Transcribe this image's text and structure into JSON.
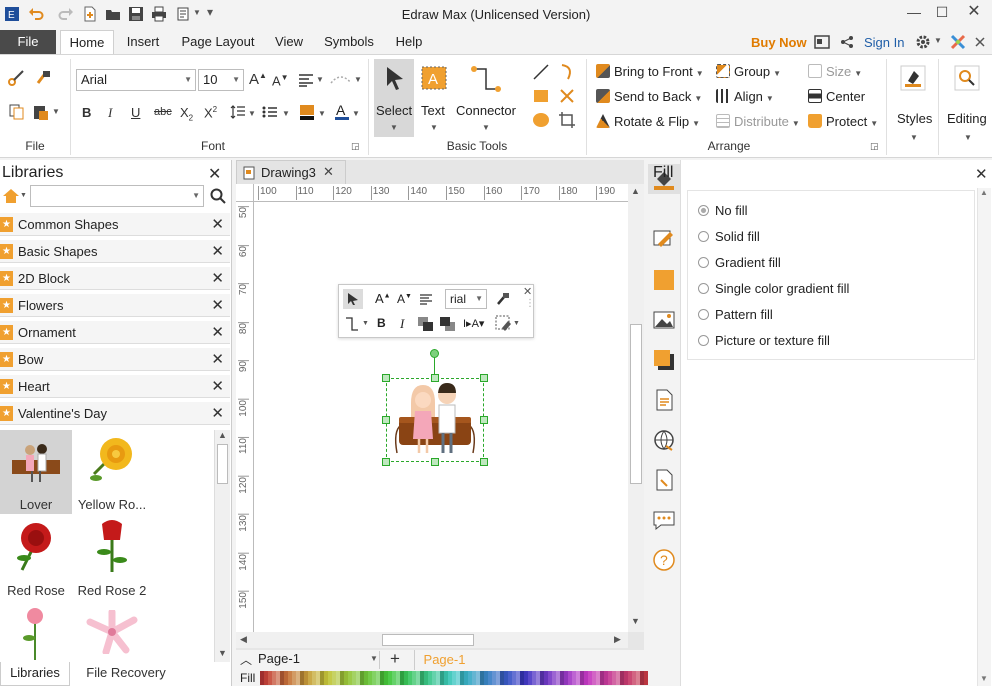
{
  "app": {
    "title": "Edraw Max (Unlicensed Version)"
  },
  "menu": {
    "file": "File",
    "tabs": [
      "Home",
      "Insert",
      "Page Layout",
      "View",
      "Symbols",
      "Help"
    ],
    "buy_now": "Buy Now",
    "sign_in": "Sign In"
  },
  "ribbon": {
    "file_group": "File",
    "font_group": "Font",
    "basic_tools_group": "Basic Tools",
    "arrange_group": "Arrange",
    "font_name": "Arial",
    "font_size": "10",
    "select": "Select",
    "text": "Text",
    "connector": "Connector",
    "bring_to_front": "Bring to Front",
    "send_to_back": "Send to Back",
    "rotate_flip": "Rotate & Flip",
    "group": "Group",
    "align": "Align",
    "distribute": "Distribute",
    "size": "Size",
    "center": "Center",
    "protect": "Protect",
    "styles": "Styles",
    "editing": "Editing"
  },
  "libraries": {
    "title": "Libraries",
    "items": [
      "Common Shapes",
      "Basic Shapes",
      "2D Block",
      "Flowers",
      "Ornament",
      "Bow",
      "Heart",
      "Valentine's Day"
    ],
    "thumbs": [
      "Lover",
      "Yellow Ro...",
      "Red Rose",
      "Red Rose 2",
      "",
      ""
    ],
    "bottom_tabs": [
      "Libraries",
      "File Recovery"
    ]
  },
  "canvas": {
    "tab_name": "Drawing3",
    "ruler_h": [
      "100",
      "110",
      "120",
      "130",
      "140",
      "150",
      "160",
      "170",
      "180",
      "190"
    ],
    "ruler_v": [
      "50",
      "60",
      "70",
      "80",
      "90",
      "100",
      "110",
      "120",
      "130",
      "140",
      "150"
    ],
    "mini_font": "rial"
  },
  "fill_panel": {
    "title": "Fill",
    "options": [
      "No fill",
      "Solid fill",
      "Gradient fill",
      "Single color gradient fill",
      "Pattern fill",
      "Picture or texture fill"
    ],
    "selected": "No fill"
  },
  "bottom": {
    "page_select": "Page-1",
    "active_page": "Page-1",
    "fill_label": "Fill"
  },
  "colors": {
    "accent": "#f0a030",
    "buy_now": "#e07b00",
    "sign_in": "#1f5ea8",
    "selection": "#2aa82a"
  }
}
